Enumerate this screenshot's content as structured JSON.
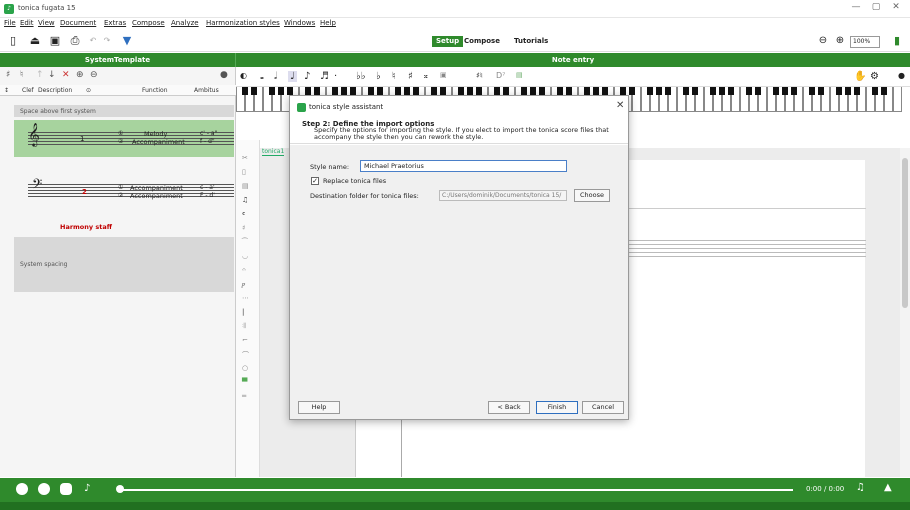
{
  "window": {
    "title": "tonica fugata 15",
    "minimize": "—",
    "maximize": "▢",
    "close": "✕"
  },
  "menu": [
    "File",
    "Edit",
    "View",
    "Document",
    "Extras",
    "Compose",
    "Analyze",
    "Harmonization styles",
    "Windows",
    "Help"
  ],
  "toolbar": {
    "modes": [
      "Setup",
      "Compose",
      "Tutorials"
    ],
    "active_mode": "Setup",
    "zoom": "100%"
  },
  "panels": {
    "left_header": "SystemTemplate",
    "right_header": "Note entry"
  },
  "columns": {
    "clef": "Clef",
    "description": "Description",
    "function": "Function",
    "ambitus": "Ambitus"
  },
  "staves": [
    {
      "description": "1",
      "functions": [
        "Melody",
        "Accompaniment"
      ],
      "ambitus": [
        "c' - a\"",
        "f - d\""
      ]
    },
    {
      "description": "2",
      "functions": [
        "Accompaniment",
        "Accompaniment"
      ],
      "ambitus": [
        "c - a'",
        "F - d'"
      ]
    }
  ],
  "system": {
    "space_above": "Space above first system",
    "harmony_staff": "Harmony staff",
    "spacing": "System spacing"
  },
  "score_tab": "tonica1",
  "dialog": {
    "title": "tonica style assistant",
    "step_title": "Step 2: Define the import options",
    "step_desc": "Specify the options for importing the style. If you elect to import the tonica score files that accompany the style then you can rework the style.",
    "style_name_label": "Style name:",
    "style_name_value": "Michael Praetorius",
    "replace_label": "Replace tonica files",
    "replace_checked": true,
    "dest_label": "Destination folder for tonica files:",
    "dest_value": "C:/Users/dominik/Documents/tonica 15/",
    "choose": "Choose",
    "help": "Help",
    "back": "< Back",
    "finish": "Finish",
    "cancel": "Cancel"
  },
  "playback": {
    "time": "0:00 / 0:00"
  },
  "colors": {
    "green": "#2f8a2c",
    "staff_green": "#a7d39e",
    "harmony_red": "#c00000"
  }
}
